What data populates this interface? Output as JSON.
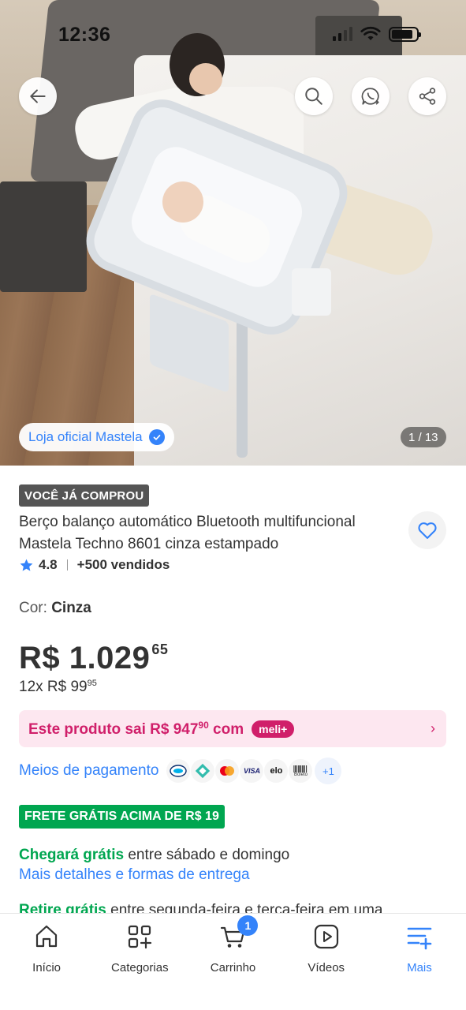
{
  "status_bar": {
    "time": "12:36"
  },
  "hero": {
    "store_label": "Loja oficial Mastela",
    "image_counter": "1 / 13"
  },
  "product": {
    "badge": "VOCÊ JÁ COMPROU",
    "title": "Berço balanço automático Bluetooth multifuncional Mastela Techno 8601 cinza estampado",
    "rating": "4.8",
    "sold": "+500 vendidos",
    "color_label": "Cor: ",
    "color_value": "Cinza"
  },
  "price": {
    "main": "R$ 1.029",
    "cents": "65",
    "installments_prefix": "12x R$ 99",
    "installments_cents": "95"
  },
  "meli_plus": {
    "text_prefix": "Este produto sai R$ 947",
    "text_cents": "90",
    "text_suffix": " com",
    "badge": "meli+"
  },
  "payment": {
    "label": "Meios de pagamento",
    "methods": [
      "mercado-pago",
      "pix",
      "mastercard",
      "visa",
      "elo",
      "boleto"
    ],
    "visa_text": "VISA",
    "elo_text": "elo",
    "boleto_text": "Boleto",
    "more": "+1"
  },
  "shipping": {
    "badge": "FRETE GRÁTIS ACIMA DE R$ 19",
    "arrival_green": "Chegará grátis",
    "arrival_rest": " entre sábado e domingo",
    "details_link": "Mais detalhes e formas de entrega",
    "pickup_green": "Retire grátis",
    "pickup_rest": " entre segunda-feira e terça-feira em uma"
  },
  "bottom_nav": {
    "items": [
      {
        "label": "Início",
        "icon": "home-icon"
      },
      {
        "label": "Categorias",
        "icon": "categories-icon"
      },
      {
        "label": "Carrinho",
        "icon": "cart-icon",
        "count": "1"
      },
      {
        "label": "Vídeos",
        "icon": "video-icon"
      },
      {
        "label": "Mais",
        "icon": "more-menu-icon",
        "active": true
      }
    ]
  },
  "colors": {
    "accent_blue": "#3483fa",
    "meli_pink": "#d01f6a",
    "green": "#00a650"
  }
}
